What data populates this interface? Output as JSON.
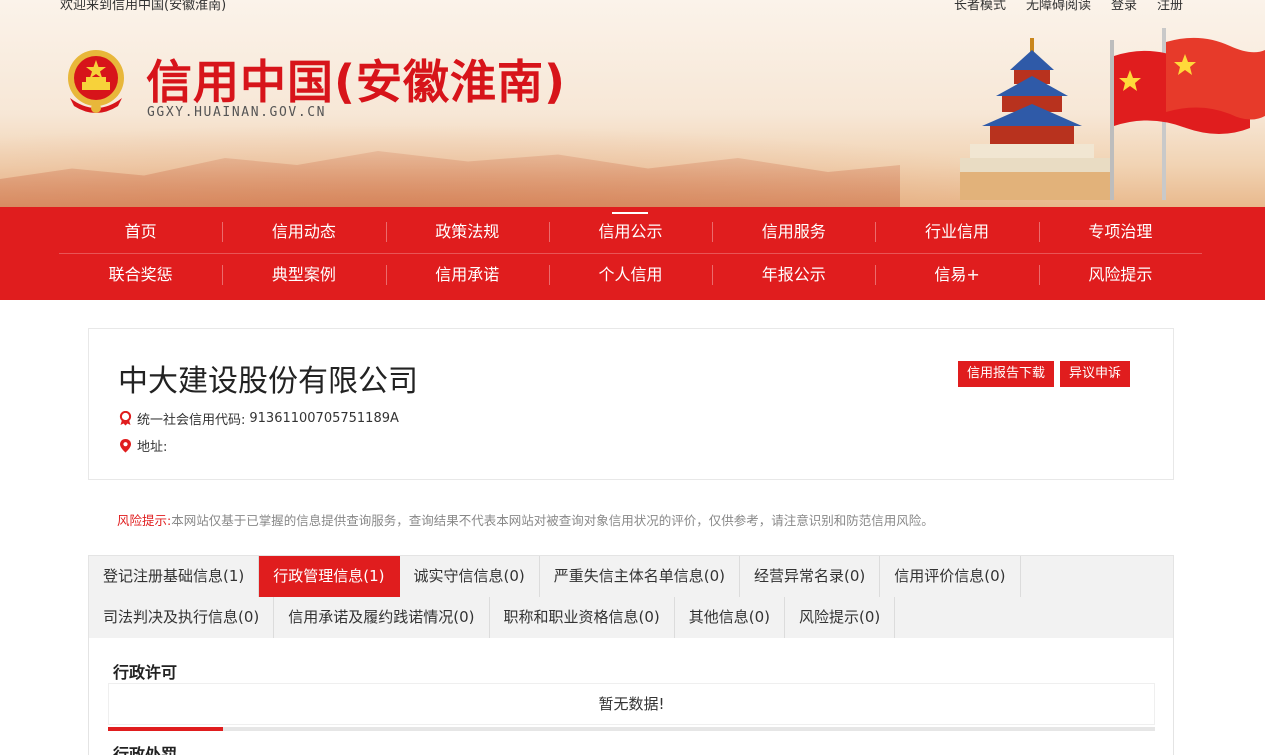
{
  "topbar": {
    "welcome": "欢迎来到信用中国(安徽淮南)",
    "links": [
      "长者模式",
      "无障碍阅读",
      "登录",
      "注册"
    ]
  },
  "site": {
    "title": "信用中国(安徽淮南)",
    "domain": "GGXY.HUAINAN.GOV.CN",
    "emblem_icon": "national-emblem-icon"
  },
  "nav": {
    "row1": [
      "首页",
      "信用动态",
      "政策法规",
      "信用公示",
      "信用服务",
      "行业信用",
      "专项治理"
    ],
    "row2": [
      "联合奖惩",
      "典型案例",
      "信用承诺",
      "个人信用",
      "年报公示",
      "信易+",
      "风险提示"
    ],
    "active": "信用公示"
  },
  "company": {
    "name": "中大建设股份有限公司",
    "credit_code_label": "统一社会信用代码:",
    "credit_code": "91361100705751189A",
    "address_label": "地址:",
    "address": "",
    "report_button": "信用报告下载",
    "appeal_button": "异议申诉"
  },
  "risk_notice": {
    "label": "风险提示:",
    "text": "本网站仅基于已掌握的信息提供查询服务，查询结果不代表本网站对被查询对象信用状况的评价，仅供参考，请注意识别和防范信用风险。"
  },
  "tabs": {
    "row1": [
      "登记注册基础信息(1)",
      "行政管理信息(1)",
      "诚实守信信息(0)",
      "严重失信主体名单信息(0)",
      "经营异常名录(0)",
      "信用评价信息(0)"
    ],
    "row2": [
      "司法判决及执行信息(0)",
      "信用承诺及履约践诺情况(0)",
      "职称和职业资格信息(0)",
      "其他信息(0)",
      "风险提示(0)"
    ],
    "active": "行政管理信息(1)"
  },
  "content": {
    "section1_title": "行政许可",
    "empty_text": "暂无数据!",
    "section2_title": "行政处罚"
  },
  "colors": {
    "brand_red": "#e01d1e",
    "title_red": "#d7141a"
  }
}
